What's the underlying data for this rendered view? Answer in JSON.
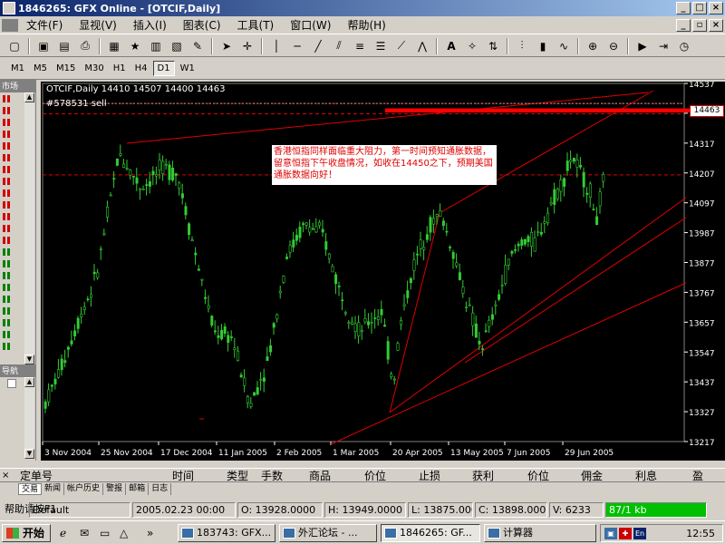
{
  "window": {
    "title": "1846265: GFX Online - [OTCIF,Daily]"
  },
  "menu": [
    "文件(F)",
    "显视(V)",
    "插入(I)",
    "图表(C)",
    "工具(T)",
    "窗口(W)",
    "帮助(H)"
  ],
  "window_buttons": [
    "_",
    "□",
    "×"
  ],
  "mdi_buttons": [
    "_",
    "▫",
    "×"
  ],
  "timeframes": [
    "M1",
    "M5",
    "M15",
    "M30",
    "H1",
    "H4",
    "D1",
    "W1"
  ],
  "active_timeframe": "D1",
  "left_panel": {
    "top_title": "市场",
    "bottom_title": "导航"
  },
  "chart": {
    "ohlc_label": "OTCIF,Daily  14410 14507 14400 14463",
    "order_label": "#578531 sell",
    "annotation": "香港恒指同样面临重大阻力，第一时间预知通胀数据，留意恒指下午收盘情况，如收在14450之下，预期美国通胀数据向好！",
    "price_tag": "14463",
    "colors": {
      "bg": "#000000",
      "candles": "#33cc33",
      "lines": "#e00000",
      "text": "#ffffff"
    }
  },
  "chart_data": {
    "type": "candlestick",
    "y_ticks": [
      "14537",
      "14427",
      "14317",
      "14207",
      "14097",
      "13987",
      "13877",
      "13767",
      "13657",
      "13547",
      "13437",
      "13327",
      "13217"
    ],
    "x_ticks": [
      "3 Nov 2004",
      "25 Nov 2004",
      "17 Dec 2004",
      "11 Jan 2005",
      "2 Feb 2005",
      "1 Mar 2005",
      "20 Apr 2005",
      "13 May 2005",
      "7 Jun 2005",
      "29 Jun 2005"
    ],
    "ylim": [
      13217,
      14537
    ],
    "current_price": 14463,
    "horizontal_levels": [
      14463,
      14425,
      14200
    ]
  },
  "terminal": {
    "columns": [
      "定单号",
      "时间",
      "类型",
      "手数",
      "商品",
      "价位",
      "止损",
      "获利",
      "价位",
      "佣金",
      "利息",
      "盈"
    ],
    "tabs": [
      "交易",
      "新闻",
      "帐户历史",
      "警报",
      "邮箱",
      "日志"
    ]
  },
  "status": {
    "help": "帮助请按F1",
    "profile": "Default",
    "date": "2005.02.23 00:00",
    "open": "O: 13928.0000",
    "high": "H: 13949.0000",
    "low": "L: 13875.0000",
    "close": "C: 13898.0000",
    "volume": "V: 6233",
    "traffic": "87/1 kb"
  },
  "taskbar": {
    "start": "开始",
    "tasks": [
      "183743: GFX...",
      "外汇论坛 - ...",
      "1846265: GF...",
      "计算器"
    ],
    "clock": "12:55",
    "lang": "En"
  }
}
